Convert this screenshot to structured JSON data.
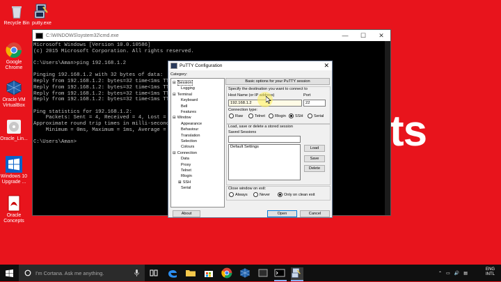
{
  "desktop": {
    "big_text": "ts",
    "icons": [
      {
        "name": "recycle-bin",
        "label": "Recycle Bin"
      },
      {
        "name": "putty-exe",
        "label": "putty.exe"
      },
      {
        "name": "google-chrome",
        "label": "Google Chrome"
      },
      {
        "name": "oracle-vm-virtualbox",
        "label": "Oracle VM VirtualBox"
      },
      {
        "name": "oracle-lin",
        "label": "Oracle_Lin..."
      },
      {
        "name": "windows-10-upgrade",
        "label": "Windows 10 Upgrade ..."
      },
      {
        "name": "oracle-concepts",
        "label": "Oracle Concepts"
      }
    ]
  },
  "cmd": {
    "title": "C:\\WINDOWS\\system32\\cmd.exe",
    "lines": [
      "Microsoft Windows [Version 10.0.10586]",
      "(c) 2015 Microsoft Corporation. All rights reserved.",
      "",
      "C:\\Users\\Aman>ping 192.168.1.2",
      "",
      "Pinging 192.168.1.2 with 32 bytes of data:",
      "Reply from 192.168.1.2: bytes=32 time<1ms TTL=",
      "Reply from 192.168.1.2: bytes=32 time<1ms TTL=",
      "Reply from 192.168.1.2: bytes=32 time<1ms TTL=",
      "Reply from 192.168.1.2: bytes=32 time<1ms TTL=",
      "",
      "Ping statistics for 192.168.1.2:",
      "    Packets: Sent = 4, Received = 4, Lost = 0",
      "Approximate round trip times in milli-seconds:",
      "    Minimum = 0ms, Maximum = 1ms, Average = 0m",
      "",
      "C:\\Users\\Aman>"
    ],
    "minimize": "—",
    "maximize": "☐",
    "close": "✕"
  },
  "putty": {
    "title": "PuTTY Configuration",
    "close": "✕",
    "category_label": "Category:",
    "tree": [
      {
        "label": "Session",
        "sign": "⊟"
      },
      {
        "label": "Logging",
        "sign": ""
      },
      {
        "label": "Terminal",
        "sign": "⊟"
      },
      {
        "label": "Keyboard",
        "sign": ""
      },
      {
        "label": "Bell",
        "sign": ""
      },
      {
        "label": "Features",
        "sign": ""
      },
      {
        "label": "Window",
        "sign": "⊟"
      },
      {
        "label": "Appearance",
        "sign": ""
      },
      {
        "label": "Behaviour",
        "sign": ""
      },
      {
        "label": "Translation",
        "sign": ""
      },
      {
        "label": "Selection",
        "sign": ""
      },
      {
        "label": "Colours",
        "sign": ""
      },
      {
        "label": "Connection",
        "sign": "⊟"
      },
      {
        "label": "Data",
        "sign": ""
      },
      {
        "label": "Proxy",
        "sign": ""
      },
      {
        "label": "Telnet",
        "sign": ""
      },
      {
        "label": "Rlogin",
        "sign": ""
      },
      {
        "label": "SSH",
        "sign": "⊞"
      },
      {
        "label": "Serial",
        "sign": ""
      }
    ],
    "header_button": "Basic options for your PuTTY session",
    "dest_label": "Specify the destination you want to connect to",
    "host_label": "Host Name (or IP address)",
    "port_label": "Port",
    "host_value": "192.168.1.2",
    "port_value": "22",
    "conn_type_label": "Connection type:",
    "conn_types": [
      "Raw",
      "Telnet",
      "Rlogin",
      "SSH",
      "Serial"
    ],
    "selected_conn_type": "SSH",
    "session_group_label": "Load, save or delete a stored session",
    "saved_sessions_label": "Saved Sessions",
    "saved_sessions_value": "",
    "sessions_list": [
      "Default Settings"
    ],
    "load_btn": "Load",
    "save_btn": "Save",
    "delete_btn": "Delete",
    "close_exit_label": "Close window on exit:",
    "close_exit_options": [
      "Always",
      "Never",
      "Only on clean exit"
    ],
    "selected_close_exit": "Only on clean exit",
    "about_btn": "About",
    "open_btn": "Open",
    "cancel_btn": "Cancel"
  },
  "taskbar": {
    "search_placeholder": "I'm Cortana. Ask me anything.",
    "lang": "ENG",
    "lang2": "INTL"
  },
  "colors": {
    "desktop_bg": "#e8141c",
    "taskbar_bg": "#101010",
    "cortana_bg": "#2b2b2b"
  }
}
